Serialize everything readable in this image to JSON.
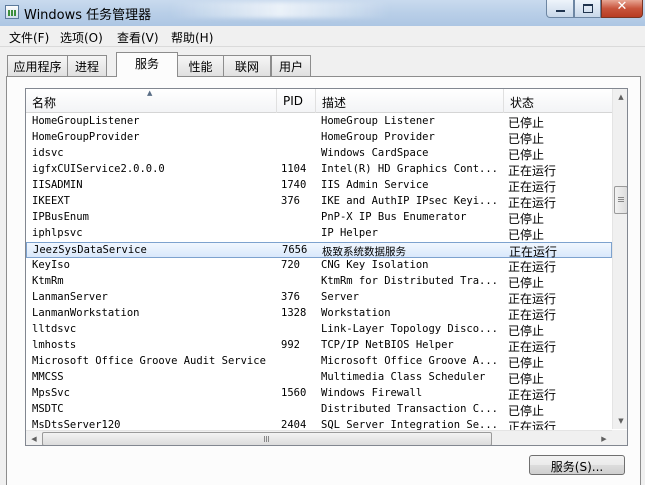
{
  "window": {
    "title": "Windows 任务管理器",
    "controls": {
      "minimize": "minimize-icon",
      "maximize": "maximize-icon",
      "close": "✕"
    }
  },
  "menu": [
    {
      "label": "文件(F)"
    },
    {
      "label": "选项(O)"
    },
    {
      "label": "查看(V)"
    },
    {
      "label": "帮助(H)"
    }
  ],
  "tabs": [
    {
      "label": "应用程序"
    },
    {
      "label": "进程"
    },
    {
      "label": "服务",
      "active": true
    },
    {
      "label": "性能"
    },
    {
      "label": "联网"
    },
    {
      "label": "用户"
    }
  ],
  "columns": {
    "name": "名称",
    "pid": "PID",
    "desc": "描述",
    "status": "状态"
  },
  "sort": {
    "column": "name",
    "direction": "ascending"
  },
  "services": [
    {
      "name": "HomeGroupListener",
      "pid": "",
      "desc": "HomeGroup Listener",
      "status": "已停止"
    },
    {
      "name": "HomeGroupProvider",
      "pid": "",
      "desc": "HomeGroup Provider",
      "status": "已停止"
    },
    {
      "name": "idsvc",
      "pid": "",
      "desc": "Windows CardSpace",
      "status": "已停止"
    },
    {
      "name": "igfxCUIService2.0.0.0",
      "pid": "1104",
      "desc": "Intel(R) HD Graphics Cont...",
      "status": "正在运行"
    },
    {
      "name": "IISADMIN",
      "pid": "1740",
      "desc": "IIS Admin Service",
      "status": "正在运行"
    },
    {
      "name": "IKEEXT",
      "pid": "376",
      "desc": "IKE and AuthIP IPsec Keyi...",
      "status": "正在运行"
    },
    {
      "name": "IPBusEnum",
      "pid": "",
      "desc": "PnP-X IP Bus Enumerator",
      "status": "已停止"
    },
    {
      "name": "iphlpsvc",
      "pid": "",
      "desc": "IP Helper",
      "status": "已停止"
    },
    {
      "name": "JeezSysDataService",
      "pid": "7656",
      "desc": "极致系统数据服务",
      "status": "正在运行",
      "selected": true
    },
    {
      "name": "KeyIso",
      "pid": "720",
      "desc": "CNG Key Isolation",
      "status": "正在运行"
    },
    {
      "name": "KtmRm",
      "pid": "",
      "desc": "KtmRm for Distributed Tra...",
      "status": "已停止"
    },
    {
      "name": "LanmanServer",
      "pid": "376",
      "desc": "Server",
      "status": "正在运行"
    },
    {
      "name": "LanmanWorkstation",
      "pid": "1328",
      "desc": "Workstation",
      "status": "正在运行"
    },
    {
      "name": "lltdsvc",
      "pid": "",
      "desc": "Link-Layer Topology Disco...",
      "status": "已停止"
    },
    {
      "name": "lmhosts",
      "pid": "992",
      "desc": "TCP/IP NetBIOS Helper",
      "status": "正在运行"
    },
    {
      "name": "Microsoft Office Groove Audit Service",
      "pid": "",
      "desc": "Microsoft Office Groove A...",
      "status": "已停止"
    },
    {
      "name": "MMCSS",
      "pid": "",
      "desc": "Multimedia Class Scheduler",
      "status": "已停止"
    },
    {
      "name": "MpsSvc",
      "pid": "1560",
      "desc": "Windows Firewall",
      "status": "正在运行"
    },
    {
      "name": "MSDTC",
      "pid": "",
      "desc": "Distributed Transaction C...",
      "status": "已停止"
    },
    {
      "name": "MsDtsServer120",
      "pid": "2404",
      "desc": "SQL Server Integration Se...",
      "status": "正在运行"
    }
  ],
  "buttons": {
    "services": "服务(S)..."
  },
  "icons": {
    "sort": "sort-up-icon",
    "scroll_up": "▲",
    "scroll_down": "▼",
    "scroll_left": "◀",
    "scroll_right": "▶"
  },
  "colors": {
    "selection": "#d9e8fb",
    "selection_border": "#7da2ce",
    "titlebar": "#b9cfe8",
    "close": "#c8543c"
  }
}
